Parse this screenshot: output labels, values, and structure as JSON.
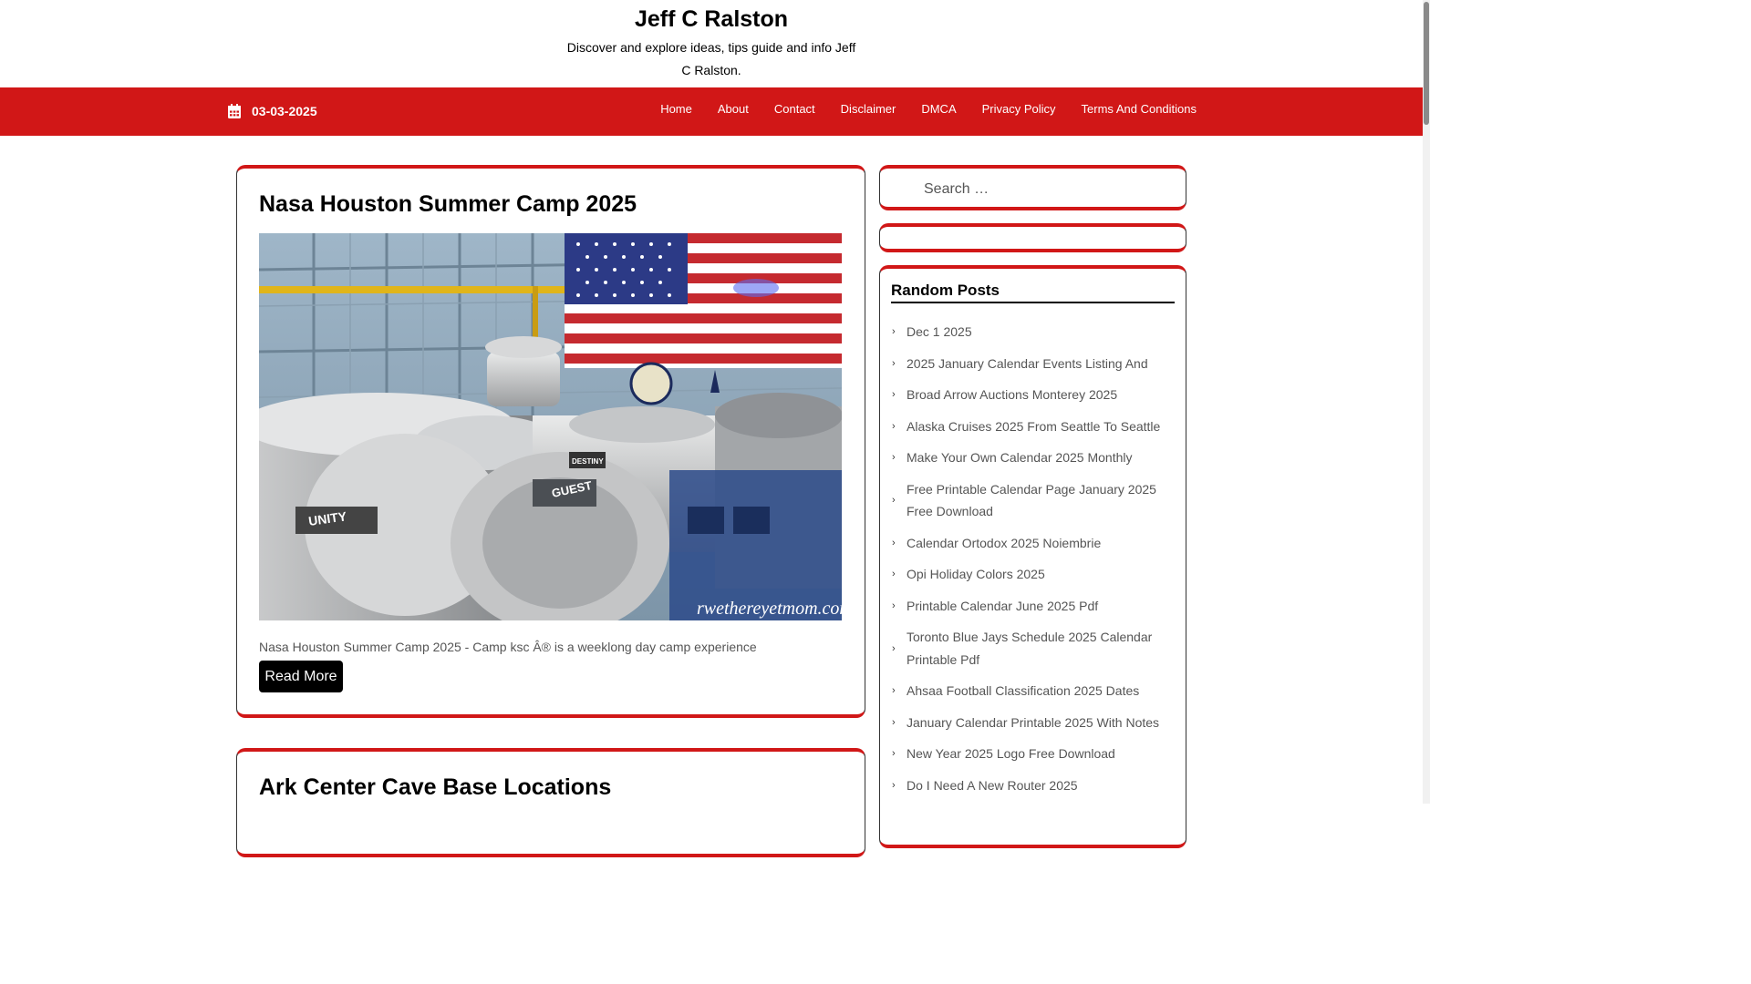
{
  "site": {
    "title": "Jeff C Ralston",
    "description": "Discover and explore ideas, tips guide and info Jeff C Ralston."
  },
  "navbar": {
    "date": "03-03-2025",
    "date_icon": "calendar-icon",
    "menu": [
      "Home",
      "About",
      "Contact",
      "Disclaimer",
      "DMCA",
      "Privacy Policy",
      "Terms And Conditions"
    ]
  },
  "posts": [
    {
      "title": "Nasa Houston Summer Camp 2025",
      "excerpt": "Nasa Houston Summer Camp 2025 - Camp ksc Â® is a weeklong day camp experience",
      "read_more": "Read More",
      "image_watermark": "rwethereyetmom.com",
      "image_labels": [
        "UNITY",
        "GUEST",
        "DESTINY"
      ]
    },
    {
      "title": "Ark Center Cave Base Locations"
    }
  ],
  "sidebar": {
    "search_placeholder": "Search …",
    "search_icon": "search-icon",
    "random_title": "Random Posts",
    "random_posts": [
      "Dec 1 2025",
      "2025 January Calendar Events Listing And",
      "Broad Arrow Auctions Monterey 2025",
      "Alaska Cruises 2025 From Seattle To Seattle",
      "Make Your Own Calendar 2025 Monthly",
      "Free Printable Calendar Page January 2025 Free Download",
      "Calendar Ortodox 2025 Noiembrie",
      "Opi Holiday Colors 2025",
      "Printable Calendar June 2025 Pdf",
      "Toronto Blue Jays Schedule 2025 Calendar Printable Pdf",
      "Ahsaa Football Classification 2025 Dates",
      "January Calendar Printable 2025 With Notes",
      "New Year 2025 Logo Free Download",
      "Do I Need A New Router 2025"
    ]
  },
  "colors": {
    "accent": "#d11717",
    "text": "#000000",
    "muted_text": "#555555"
  }
}
